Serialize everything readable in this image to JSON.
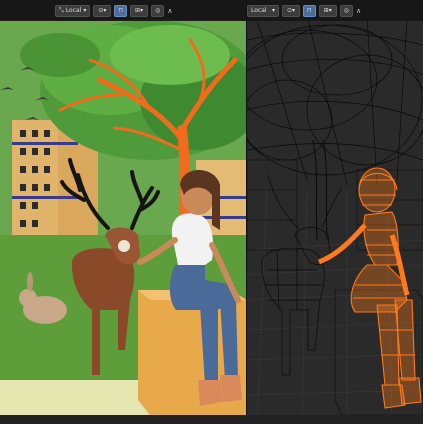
{
  "viewports": [
    {
      "name": "Rendered view",
      "header": {
        "transform_orientation": "Local",
        "snap_icon": "magnet-icon",
        "proportional_icon": "proportional-edit-icon",
        "falloff_icon": "falloff-curve-icon",
        "pivot_icon": "pivot-point-icon"
      }
    },
    {
      "name": "Wireframe view",
      "header": {
        "transform_orientation": "Local",
        "snap_icon": "magnet-icon",
        "proportional_icon": "proportional-edit-icon",
        "falloff_icon": "falloff-curve-icon",
        "pivot_icon": "pivot-point-icon"
      }
    }
  ],
  "colors": {
    "selection_orange": "#ff7a1a",
    "background_dark": "#1e1e1e",
    "wire_black": "#0a0a0a",
    "sky_green": "#6aa84f",
    "grass": "#5d9e3a",
    "tree_foliage": "#4f9a3a",
    "trunk_orange": "#f26b1d",
    "building": "#e0b46a"
  }
}
